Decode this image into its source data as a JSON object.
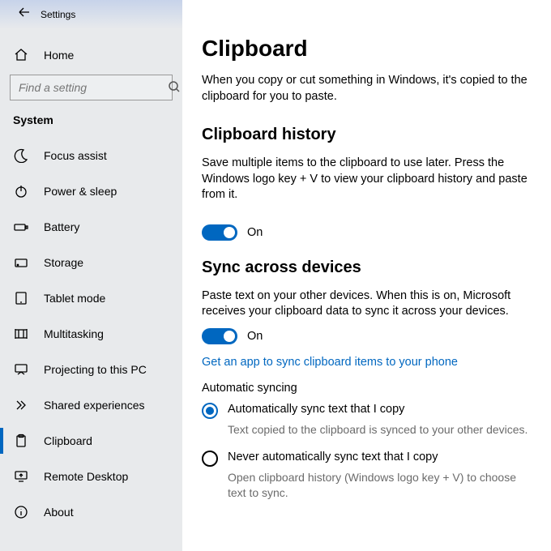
{
  "window": {
    "title": "Settings"
  },
  "sidebar": {
    "home": "Home",
    "search_placeholder": "Find a setting",
    "section": "System",
    "items": [
      {
        "key": "focus-assist",
        "label": "Focus assist"
      },
      {
        "key": "power-sleep",
        "label": "Power & sleep"
      },
      {
        "key": "battery",
        "label": "Battery"
      },
      {
        "key": "storage",
        "label": "Storage"
      },
      {
        "key": "tablet-mode",
        "label": "Tablet mode"
      },
      {
        "key": "multitasking",
        "label": "Multitasking"
      },
      {
        "key": "projecting",
        "label": "Projecting to this PC"
      },
      {
        "key": "shared-experiences",
        "label": "Shared experiences"
      },
      {
        "key": "clipboard",
        "label": "Clipboard"
      },
      {
        "key": "remote-desktop",
        "label": "Remote Desktop"
      },
      {
        "key": "about",
        "label": "About"
      }
    ]
  },
  "main": {
    "title": "Clipboard",
    "intro": "When you copy or cut something in Windows, it's copied to the clipboard for you to paste.",
    "history": {
      "heading": "Clipboard history",
      "desc": "Save multiple items to the clipboard to use later. Press the Windows logo key + V to view your clipboard history and paste from it.",
      "toggle_state": "On"
    },
    "sync": {
      "heading": "Sync across devices",
      "desc": "Paste text on your other devices. When this is on, Microsoft receives your clipboard data to sync it across your devices.",
      "toggle_state": "On",
      "link": "Get an app to sync clipboard items to your phone",
      "auto_heading": "Automatic syncing",
      "opt1_label": "Automatically sync text that I copy",
      "opt1_sub": "Text copied to the clipboard is synced to your other devices.",
      "opt2_label": "Never automatically sync text that I copy",
      "opt2_sub": "Open clipboard history (Windows logo key + V) to choose text to sync."
    }
  }
}
